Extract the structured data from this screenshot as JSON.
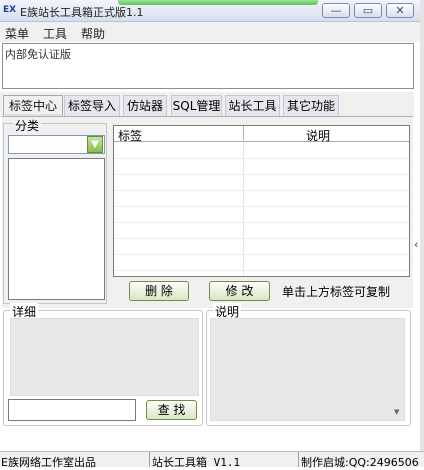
{
  "window": {
    "title": "E族站长工具箱正式版1.1",
    "icon_text": "EX",
    "min_label": "—",
    "max_label": "▭",
    "close_label": "✕"
  },
  "menu": {
    "items": [
      "菜单",
      "工具",
      "帮助"
    ]
  },
  "notice": {
    "text": "内部免认证版"
  },
  "tabs": [
    "标签中心",
    "标签导入",
    "仿站器",
    "SQL管理",
    "站长工具",
    "其它功能"
  ],
  "category": {
    "legend": "分类",
    "selected": "",
    "dropdown_glyph": "▼"
  },
  "tag_table": {
    "columns": [
      "标签",
      "说明"
    ],
    "rows": []
  },
  "actions": {
    "delete_label": "删  除",
    "edit_label": "修  改",
    "copy_hint": "单击上方标签可复制"
  },
  "detail": {
    "legend": "详细",
    "search_value": "",
    "search_label": "查  找"
  },
  "description": {
    "legend": "说明"
  },
  "status_bar": {
    "left": "E族网络工作室出品",
    "middle": "站长工具箱 V1.1",
    "right": "制作启城:QQ:2496506"
  }
}
